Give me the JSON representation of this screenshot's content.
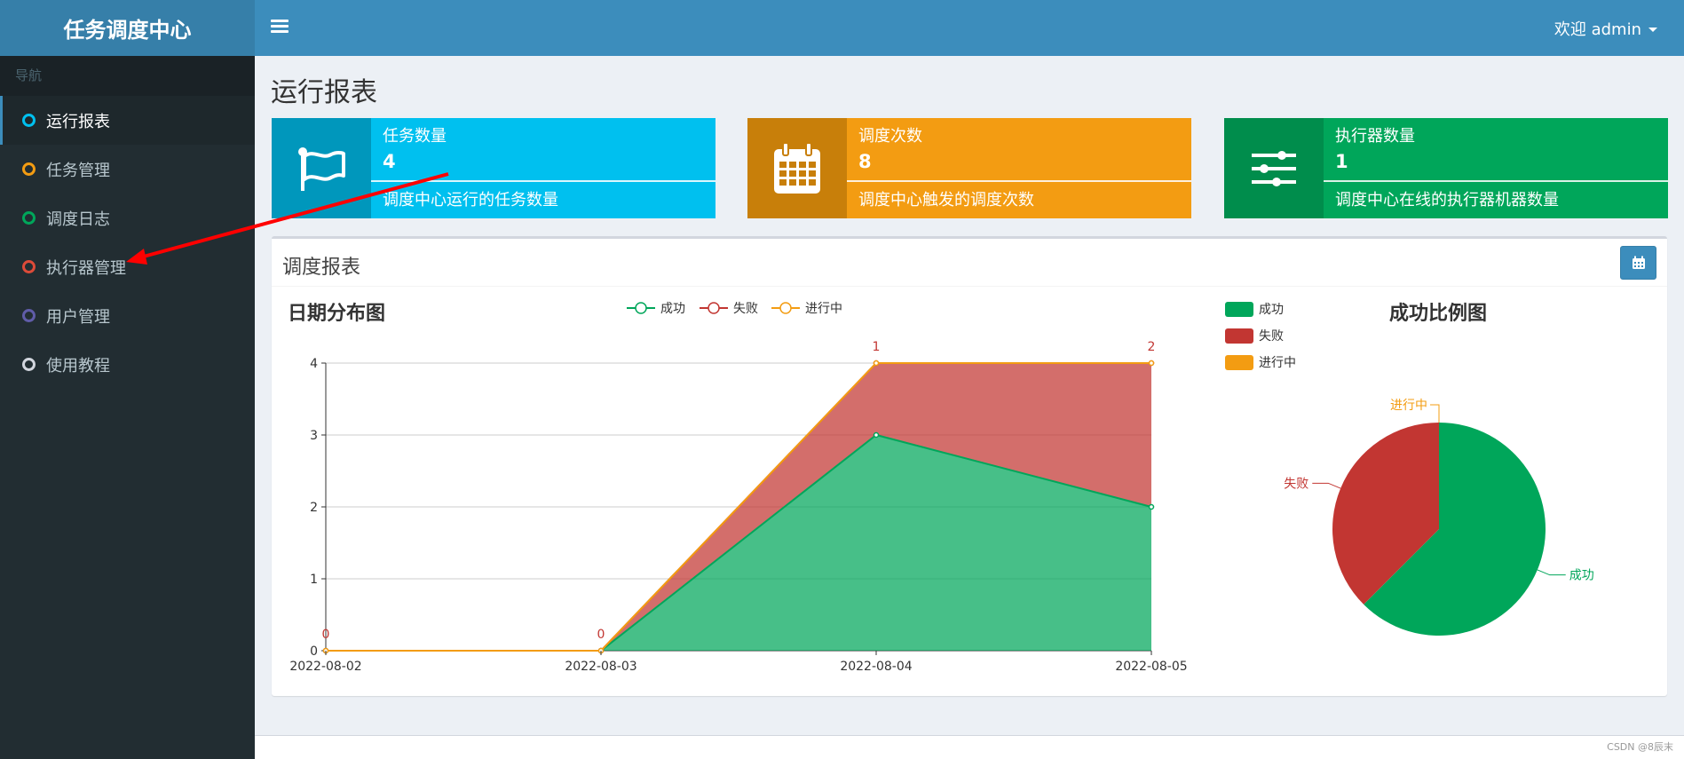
{
  "app": {
    "title": "任务调度中心"
  },
  "header": {
    "welcome": "欢迎 admin"
  },
  "sidebar": {
    "header": "导航",
    "items": [
      {
        "label": "运行报表",
        "color": "#00c0ef"
      },
      {
        "label": "任务管理",
        "color": "#f39c12"
      },
      {
        "label": "调度日志",
        "color": "#00a65a"
      },
      {
        "label": "执行器管理",
        "color": "#dd4b39"
      },
      {
        "label": "用户管理",
        "color": "#605ca8"
      },
      {
        "label": "使用教程",
        "color": "#d2d6de"
      }
    ]
  },
  "page": {
    "title": "运行报表"
  },
  "info_boxes": [
    {
      "label": "任务数量",
      "value": "4",
      "desc": "调度中心运行的任务数量",
      "color": "#00c0ef",
      "icon_color": "#0097bc",
      "icon": "flag-icon"
    },
    {
      "label": "调度次数",
      "value": "8",
      "desc": "调度中心触发的调度次数",
      "color": "#f39c12",
      "icon_color": "#c87f0a",
      "icon": "calendar-icon"
    },
    {
      "label": "执行器数量",
      "value": "1",
      "desc": "调度中心在线的执行器机器数量",
      "color": "#00a65a",
      "icon_color": "#008d4c",
      "icon": "sliders-icon"
    }
  ],
  "panel": {
    "title": "调度报表"
  },
  "chart_data": [
    {
      "type": "area",
      "title": "日期分布图",
      "categories": [
        "2022-08-02",
        "2022-08-03",
        "2022-08-04",
        "2022-08-05"
      ],
      "stacked": true,
      "series": [
        {
          "name": "成功",
          "values": [
            0,
            0,
            3,
            2
          ],
          "color": "#00a65a"
        },
        {
          "name": "失败",
          "values": [
            0,
            0,
            1,
            2
          ],
          "color": "#c23632"
        },
        {
          "name": "进行中",
          "values": [
            0,
            0,
            0,
            0
          ],
          "color": "#f39c12"
        }
      ],
      "data_labels": [
        "0",
        "0",
        "1",
        "2"
      ],
      "ylim": [
        0,
        4
      ],
      "yticks": [
        0,
        1,
        2,
        3,
        4
      ],
      "legend_position": "top"
    },
    {
      "type": "pie",
      "title": "成功比例图",
      "labels": [
        "成功",
        "失败",
        "进行中"
      ],
      "values": [
        5,
        3,
        0
      ],
      "colors": [
        "#00a65a",
        "#c23632",
        "#f39c12"
      ],
      "legend_position": "top-left"
    }
  ],
  "footer": {
    "watermark": "CSDN @8辰末"
  }
}
